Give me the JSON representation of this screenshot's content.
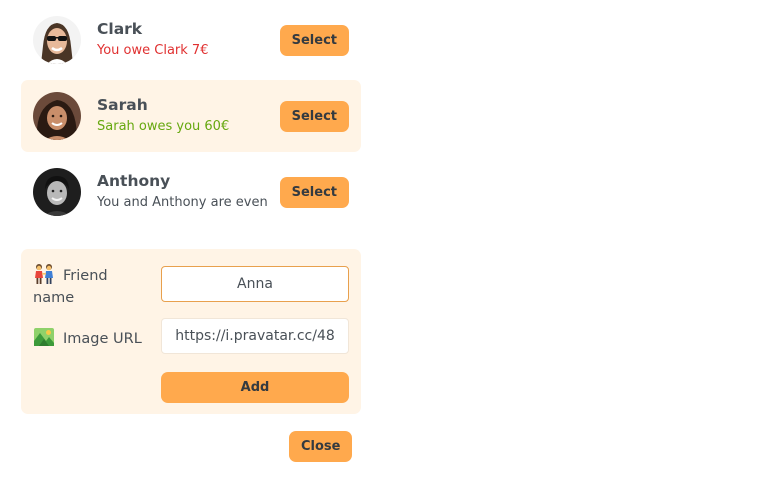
{
  "friends": [
    {
      "name": "Clark",
      "status": "You owe Clark 7€",
      "status_kind": "red",
      "select_label": "Select",
      "selected": false
    },
    {
      "name": "Sarah",
      "status": "Sarah owes you 60€",
      "status_kind": "green",
      "select_label": "Select",
      "selected": true
    },
    {
      "name": "Anthony",
      "status": "You and Anthony are even",
      "status_kind": "neutral",
      "select_label": "Select",
      "selected": false
    }
  ],
  "form": {
    "friend_name_label": "Friend name",
    "friend_name_value": "Anna",
    "friend_name_icon": "people-holding-hands-icon",
    "image_url_label": "Image URL",
    "image_url_value": "https://i.pravatar.cc/48",
    "image_url_icon": "landscape-image-icon",
    "add_label": "Add"
  },
  "close_label": "Close",
  "colors": {
    "accent": "#ffa94d",
    "selected_bg": "#fff4e6",
    "owe_red": "#e03131",
    "owed_green": "#66a80f",
    "text": "#495057"
  }
}
